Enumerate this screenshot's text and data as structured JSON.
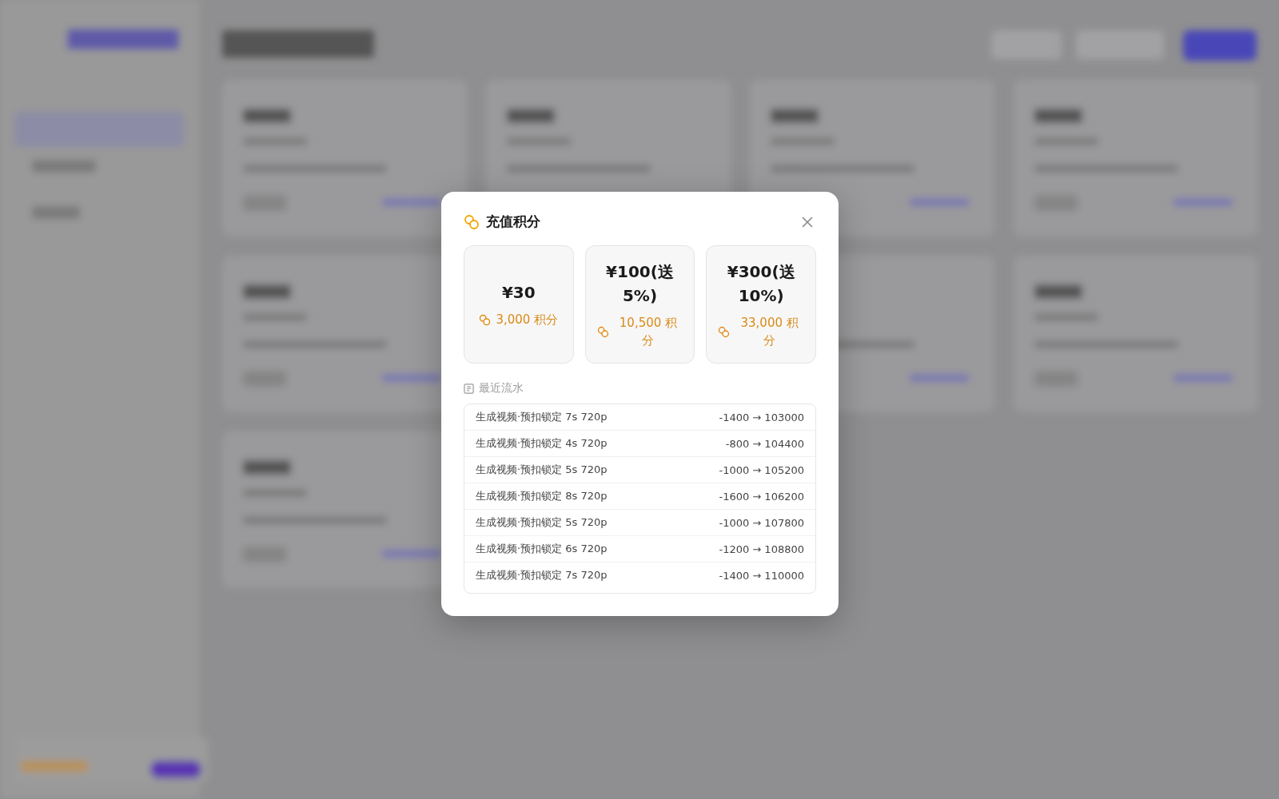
{
  "dialog": {
    "title": "充值积分",
    "packages": [
      {
        "price": "¥30",
        "points": "3,000 积分"
      },
      {
        "price": "¥100(送5%)",
        "points": "10,500 积分"
      },
      {
        "price": "¥300(送10%)",
        "points": "33,000 积分"
      }
    ],
    "history": {
      "title": "最近流水",
      "rows": [
        {
          "description": "生成视频·预扣锁定 7s 720p",
          "change": "-1400 → 103000"
        },
        {
          "description": "生成视频·预扣锁定 4s 720p",
          "change": "-800 → 104400"
        },
        {
          "description": "生成视频·预扣锁定 5s 720p",
          "change": "-1000 → 105200"
        },
        {
          "description": "生成视频·预扣锁定 8s 720p",
          "change": "-1600 → 106200"
        },
        {
          "description": "生成视频·预扣锁定 5s 720p",
          "change": "-1000 → 107800"
        },
        {
          "description": "生成视频·预扣锁定 6s 720p",
          "change": "-1200 → 108800"
        },
        {
          "description": "生成视频·预扣锁定 7s 720p",
          "change": "-1400 → 110000"
        }
      ]
    }
  }
}
